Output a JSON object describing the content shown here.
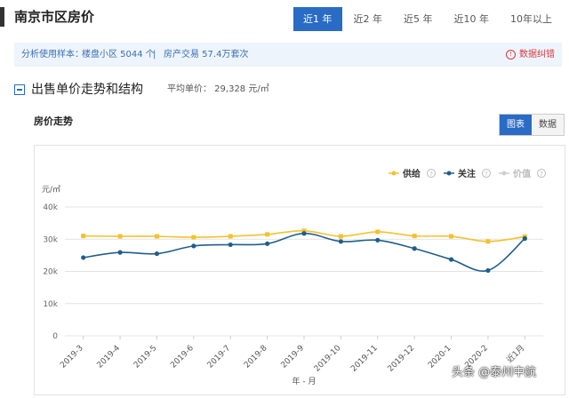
{
  "header": {
    "title": "南京市区房价",
    "tabs": [
      {
        "label": "近1 年",
        "active": true
      },
      {
        "label": "近2 年",
        "active": false
      },
      {
        "label": "近5 年",
        "active": false
      },
      {
        "label": "近10 年",
        "active": false
      },
      {
        "label": "10年以上",
        "active": false
      }
    ]
  },
  "info_bar": {
    "sample_label": "分析使用样本：",
    "sample_value": "楼盘小区 5044 个",
    "separator": "|",
    "trade_label": "房产交易 57.4万套次",
    "report_label": "数据纠错",
    "accent_color": "#3a6fb5",
    "report_color": "#d9393e"
  },
  "section": {
    "title": "出售单价走势和结构",
    "avg_price": "平均单价： 29,328 元/㎡",
    "subhead": "房价走势",
    "view_buttons": [
      {
        "label": "图表",
        "active": true
      },
      {
        "label": "数据",
        "active": false
      }
    ]
  },
  "chart_data": {
    "type": "line",
    "y_unit_label": "元/㎡",
    "xlabel": "年 - 月",
    "categories": [
      "2019-3",
      "2019-4",
      "2019-5",
      "2019-6",
      "2019-7",
      "2019-8",
      "2019-9",
      "2019-10",
      "2019-11",
      "2019-12",
      "2020-1",
      "2020-2",
      "近1月"
    ],
    "y_ticks": [
      "0",
      "10k",
      "20k",
      "30k",
      "40k"
    ],
    "ylim": [
      0,
      40000
    ],
    "grid": true,
    "legend_position": "top-right",
    "series": [
      {
        "name": "供给",
        "color": "#f2c230",
        "visible": true,
        "values": [
          31000,
          30900,
          30900,
          30600,
          30900,
          31500,
          32600,
          30900,
          32300,
          31000,
          30900,
          29300,
          30800
        ]
      },
      {
        "name": "关注",
        "color": "#1f5d8c",
        "visible": true,
        "values": [
          24300,
          25900,
          25500,
          27900,
          28300,
          28600,
          31800,
          29300,
          29700,
          27100,
          23700,
          20300,
          30200
        ]
      },
      {
        "name": "价值",
        "color": "#c8c8c8",
        "visible": false,
        "values": []
      }
    ]
  },
  "watermark": "头条 @泰州中航"
}
